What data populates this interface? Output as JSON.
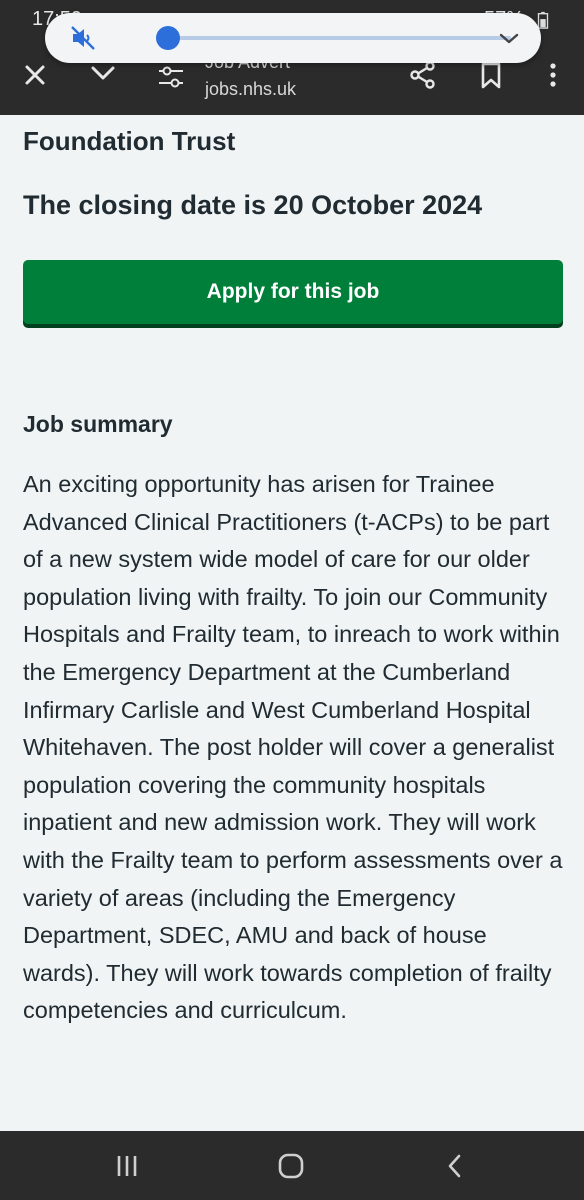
{
  "status_bar": {
    "time": "17:59",
    "battery": "57%"
  },
  "volume_panel": {
    "muted": true,
    "level": 0
  },
  "toolbar": {
    "title": "Job Advert",
    "url": "jobs.nhs.uk",
    "icons": [
      "close-icon",
      "chevron-down-icon",
      "customize-icon",
      "share-icon",
      "bookmark-icon",
      "more-icon"
    ]
  },
  "job": {
    "organisation_fragment": "Foundation Trust",
    "closing_date": "The closing date is 20 October 2024",
    "apply_label": "Apply for this job",
    "summary_heading": "Job summary",
    "summary_text": "An exciting opportunity has arisen for Trainee Advanced Clinical Practitioners (t-ACPs) to be part of a new system wide model of care for our older population living with frailty. To join our Community Hospitals and Frailty team, to inreach to work within the Emergency Department at the Cumberland Infirmary Carlisle and West Cumberland Hospital Whitehaven. The post holder will cover a generalist population covering the community hospitals inpatient and new admission work. They will work with the Frailty team to perform assessments over a variety of areas (including the Emergency Department, SDEC, AMU and back of house wards). They will work towards completion of frailty competencies and curriculcum."
  },
  "colors": {
    "apply_green": "#007f3b",
    "text": "#212b32",
    "background": "#f0f4f5",
    "chrome": "#2b2b2b"
  },
  "nav_bar": {
    "icons": [
      "recents-icon",
      "home-icon",
      "back-icon"
    ]
  }
}
